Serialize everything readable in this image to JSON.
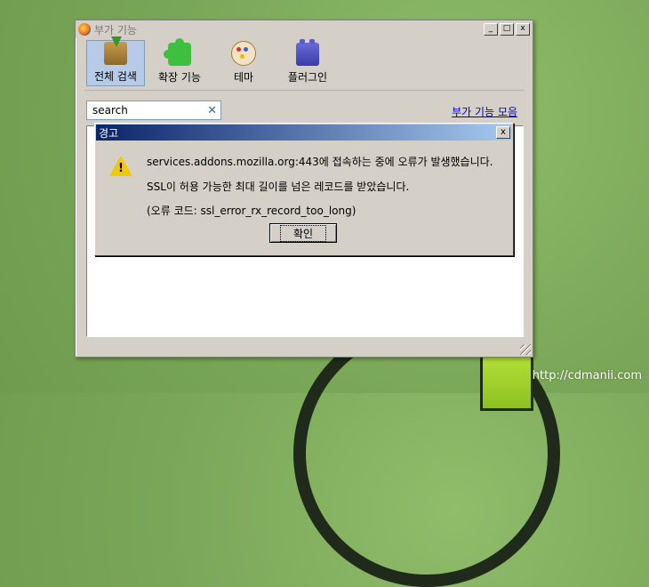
{
  "window": {
    "title": "부가 기능",
    "minimize": "_",
    "maximize": "□",
    "close": "x"
  },
  "toolbar": {
    "items": [
      {
        "label": "전체 검색",
        "icon": "get-addons-icon",
        "selected": true
      },
      {
        "label": "확장 기능",
        "icon": "puzzle-icon",
        "selected": false
      },
      {
        "label": "테마",
        "icon": "palette-icon",
        "selected": false
      },
      {
        "label": "플러그인",
        "icon": "plugin-icon",
        "selected": false
      }
    ]
  },
  "search": {
    "value": "search",
    "clear": "✕"
  },
  "gallery_link": "부가 기능 모음",
  "dialog": {
    "title": "경고",
    "close": "x",
    "icon": "warning-icon",
    "line1": "services.addons.mozilla.org:443에 접속하는 중에 오류가 발생했습니다.",
    "line2": "SSL이 허용 가능한 최대 길이를 넘은 레코드를 받았습니다.",
    "line3": "(오류 코드: ssl_error_rx_record_too_long)",
    "ok": "확인"
  },
  "watermark": "http://cdmanii.com"
}
